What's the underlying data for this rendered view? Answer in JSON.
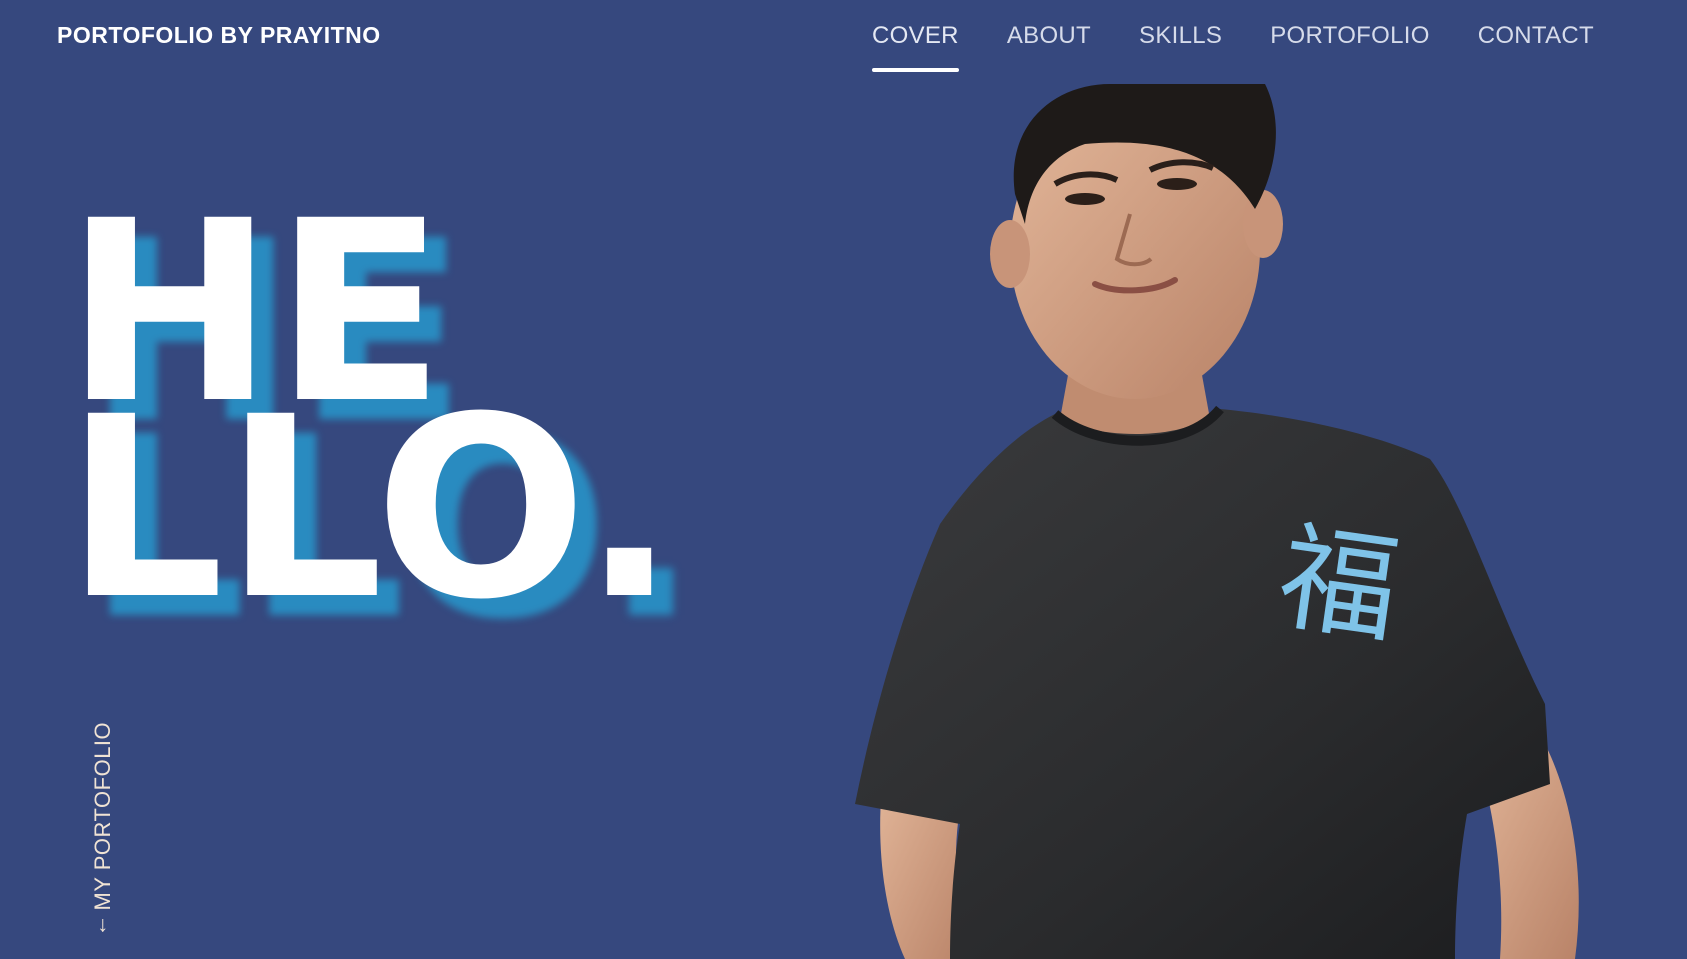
{
  "header": {
    "brand": "PORTOFOLIO BY PRAYITNO",
    "nav": [
      {
        "label": "COVER",
        "active": true
      },
      {
        "label": "ABOUT",
        "active": false
      },
      {
        "label": "SKILLS",
        "active": false
      },
      {
        "label": "PORTOFOLIO",
        "active": false
      },
      {
        "label": "CONTACT",
        "active": false
      }
    ]
  },
  "hero": {
    "line1": "HE",
    "line2": "LLO."
  },
  "side_link": {
    "icon": "arrow-down-icon",
    "arrow": "↓",
    "label": "MY PORTOFOLIO"
  },
  "portrait": {
    "shirt_glyph": "福"
  },
  "colors": {
    "background": "#36487e",
    "accent_shadow": "#298fc4",
    "text": "#ffffff",
    "nav_text": "#d6dbea",
    "side_link": "#f0e3d4",
    "shirt": "#2b2c2e",
    "shirt_print": "#7fc3e8"
  }
}
